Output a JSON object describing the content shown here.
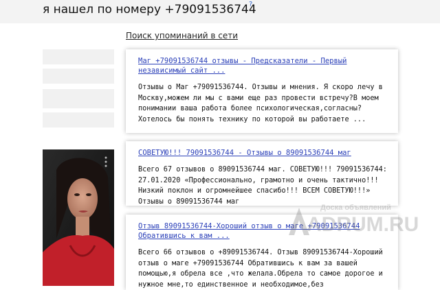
{
  "header": {
    "title": "я нашел по номеру +79091536744",
    "help_mark": "?"
  },
  "section_link": "Поиск упоминаний в сети",
  "results": [
    {
      "title": "Маг +79091536744 отзывы - Предсказатели - Первый независимый сайт ...",
      "snippet": "Отзывы о Маг +79091536744. Отзывы и мнения. Я скоро лечу в Москву,можем ли мы с вами еще раз провести встречу?В моем понимании ваша работа более психологическая,согласны?Хотелось бы понять технику по которой вы работаете ..."
    },
    {
      "title": "СОВЕТУЮ!!! 79091536744 - Отзывы о 89091536744 маг",
      "snippet": "Всего 67 отзывов о 89091536744 маг. СОВЕТУЮ!!! 79091536744: 27.01.2020 «Профессионально, грамотно и очень тактично!!! Низкий поклон и огромнейшее спасибо!!! ВСЕМ СОВЕТУЮ!!!» Отзывы о 89091536744 маг"
    },
    {
      "title": "Отзыв 89091536744-Хороший отзыв о маге +79091536744 Обратившись к вам ...",
      "snippet": "Всего 66 отзывов о +89091536744. Отзыв 89091536744-Хороший отзыв о маге +79091536744 Обратившись к вам за вашей помощью,я обрела все ,что желала.Обрела то самое дорогое и нужное мне,то единственное и необходимое,без"
    }
  ],
  "watermark": {
    "line1": "Доска объявлений",
    "line2": "ADRUM.RU"
  }
}
